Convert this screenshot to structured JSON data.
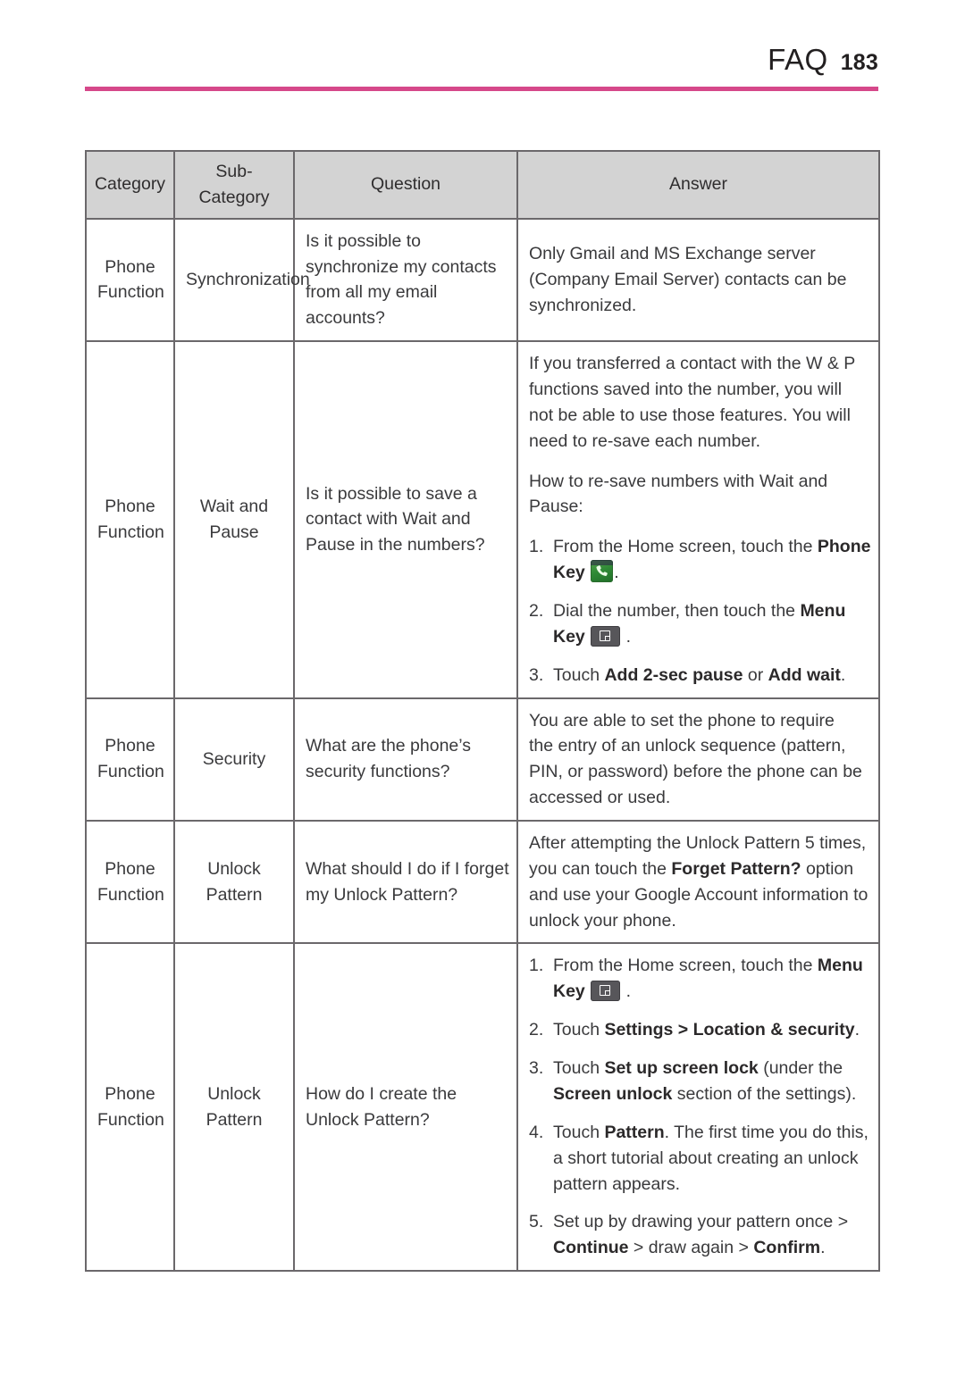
{
  "header": {
    "title": "FAQ",
    "page_number": "183",
    "rule_color": "#d6488a"
  },
  "table": {
    "columns": [
      "Category",
      "Sub-Category",
      "Question",
      "Answer"
    ],
    "rows": [
      {
        "category": [
          "Phone",
          "Function"
        ],
        "subcategory": [
          "Synchronization"
        ],
        "question": [
          "Is it possible to",
          "synchronize my contacts",
          "from all my email",
          "accounts?"
        ],
        "answer_paragraphs": [
          [
            "Only Gmail and MS Exchange server",
            "(Company Email Server) contacts can be",
            "synchronized."
          ]
        ],
        "answer_steps": []
      },
      {
        "category": [
          "Phone",
          "Function"
        ],
        "subcategory": [
          "Wait and",
          "Pause"
        ],
        "question": [
          "Is it possible to save a",
          "contact with Wait and",
          "Pause in the numbers?"
        ],
        "answer_paragraphs": [
          [
            "If you transferred a contact with the W & P",
            "functions saved into the number, you will",
            "not be able to use those features. You will",
            "need to re-save each number."
          ],
          [
            "How to re-save numbers with Wait and",
            "Pause:"
          ]
        ],
        "answer_steps": [
          {
            "number": "1.",
            "lines": [
              [
                {
                  "t": "From the Home screen, touch the ",
                  "b": false
                },
                {
                  "t": "Phone",
                  "b": true
                }
              ],
              [
                {
                  "t": "Key ",
                  "b": true
                },
                {
                  "icon": "phone-key-icon"
                },
                {
                  "t": ".",
                  "b": false
                }
              ]
            ]
          },
          {
            "number": "2.",
            "lines": [
              [
                {
                  "t": "Dial the number, then touch the ",
                  "b": false
                },
                {
                  "t": "Menu",
                  "b": true
                }
              ],
              [
                {
                  "t": "Key ",
                  "b": true
                },
                {
                  "icon": "menu-key-icon"
                },
                {
                  "t": " .",
                  "b": false
                }
              ]
            ]
          },
          {
            "number": "3.",
            "lines": [
              [
                {
                  "t": "Touch ",
                  "b": false
                },
                {
                  "t": "Add 2-sec pause",
                  "b": true
                },
                {
                  "t": " or ",
                  "b": false
                },
                {
                  "t": "Add wait",
                  "b": true
                },
                {
                  "t": ".",
                  "b": false
                }
              ]
            ]
          }
        ]
      },
      {
        "category": [
          "Phone",
          "Function"
        ],
        "subcategory": [
          "Security"
        ],
        "question": [
          "What are the phone’s",
          "security functions?"
        ],
        "answer_paragraphs": [
          [
            "You are able to set the phone to require",
            "the entry of an unlock sequence (pattern,",
            "PIN, or password) before the phone can be",
            "accessed or used."
          ]
        ],
        "answer_steps": []
      },
      {
        "category": [
          "Phone",
          "Function"
        ],
        "subcategory": [
          "Unlock",
          "Pattern"
        ],
        "question": [
          "What should I do if I forget",
          "my Unlock Pattern?"
        ],
        "answer_paragraphs": [],
        "answer_steps": [],
        "answer_rich": [
          [
            {
              "t": "After attempting the Unlock Pattern 5 times,",
              "b": false
            }
          ],
          [
            {
              "t": "you can touch the ",
              "b": false
            },
            {
              "t": "Forget Pattern?",
              "b": true
            },
            {
              "t": " option",
              "b": false
            }
          ],
          [
            {
              "t": "and use your Google Account information to",
              "b": false
            }
          ],
          [
            {
              "t": "unlock your phone.",
              "b": false
            }
          ]
        ]
      },
      {
        "category": [
          "Phone",
          "Function"
        ],
        "subcategory": [
          "Unlock",
          "Pattern"
        ],
        "question": [
          "How do I create the",
          "Unlock Pattern?"
        ],
        "answer_paragraphs": [],
        "answer_steps": [
          {
            "number": "1.",
            "lines": [
              [
                {
                  "t": "From the Home screen, touch the ",
                  "b": false
                },
                {
                  "t": "Menu",
                  "b": true
                }
              ],
              [
                {
                  "t": "Key ",
                  "b": true
                },
                {
                  "icon": "menu-key-icon"
                },
                {
                  "t": " .",
                  "b": false
                }
              ]
            ]
          },
          {
            "number": "2.",
            "lines": [
              [
                {
                  "t": "Touch ",
                  "b": false
                },
                {
                  "t": "Settings > Location & security",
                  "b": true
                },
                {
                  "t": ".",
                  "b": false
                }
              ]
            ]
          },
          {
            "number": "3.",
            "lines": [
              [
                {
                  "t": "Touch ",
                  "b": false
                },
                {
                  "t": "Set up screen lock",
                  "b": true
                },
                {
                  "t": " (under the",
                  "b": false
                }
              ],
              [
                {
                  "t": "Screen unlock",
                  "b": true
                },
                {
                  "t": " section of the settings).",
                  "b": false
                }
              ]
            ]
          },
          {
            "number": "4.",
            "lines": [
              [
                {
                  "t": "Touch ",
                  "b": false
                },
                {
                  "t": "Pattern",
                  "b": true
                },
                {
                  "t": ". The first time you do this,",
                  "b": false
                }
              ],
              [
                {
                  "t": "a short tutorial about creating an unlock",
                  "b": false
                }
              ],
              [
                {
                  "t": "pattern appears.",
                  "b": false
                }
              ]
            ]
          },
          {
            "number": "5.",
            "lines": [
              [
                {
                  "t": "Set up by drawing your pattern once >",
                  "b": false
                }
              ],
              [
                {
                  "t": "Continue",
                  "b": true
                },
                {
                  "t": " > draw again > ",
                  "b": false
                },
                {
                  "t": "Confirm",
                  "b": true
                },
                {
                  "t": ".",
                  "b": false
                }
              ]
            ]
          }
        ]
      }
    ]
  }
}
